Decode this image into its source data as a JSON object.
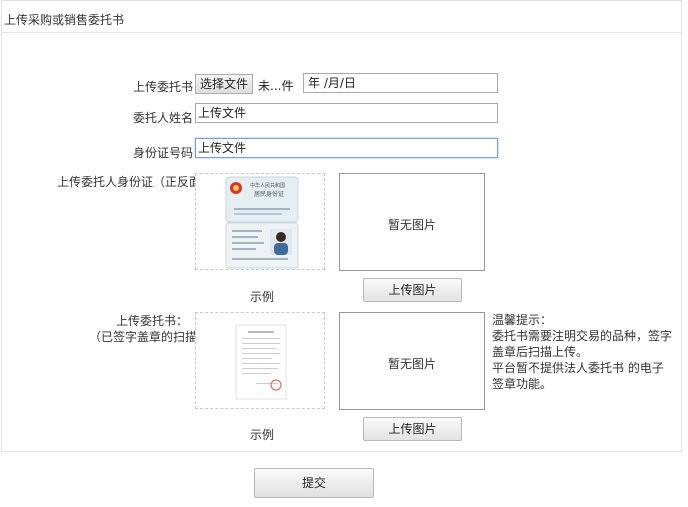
{
  "panel": {
    "title": "上传采购或销售委托书"
  },
  "form": {
    "letter_label": "上传委托书",
    "file_button": "选择文件",
    "file_status": "未...件",
    "date_value": "年 /月/日",
    "name_label": "委托人姓名",
    "name_value": "上传文件",
    "idno_label": "身份证号码",
    "idno_value": "上传文件",
    "id_upload_label": "上传委托人身份证（正反面",
    "id_card_texts": [
      "中华人民共和国",
      "居民身份证"
    ],
    "id_sample_caption": "示例",
    "id_preview_text": "暂无图片",
    "id_upload_button": "上传图片",
    "letter_upload_label_1": "上传委托书：",
    "letter_upload_label_2": "（已签字盖章的扫描",
    "letter_sample_caption": "示例",
    "letter_preview_text": "暂无图片",
    "letter_upload_button": "上传图片",
    "submit_button": "提交"
  },
  "tip": {
    "title": "温馨提示：",
    "lines": [
      "委托书需要注明交易的品种，签字盖章后扫描上传。",
      "平台暂不提供法人委托书 的电子签章功能。"
    ]
  },
  "colors": {
    "border": "#e1e1e1",
    "focus": "#7a9cd3",
    "text": "#333333"
  }
}
